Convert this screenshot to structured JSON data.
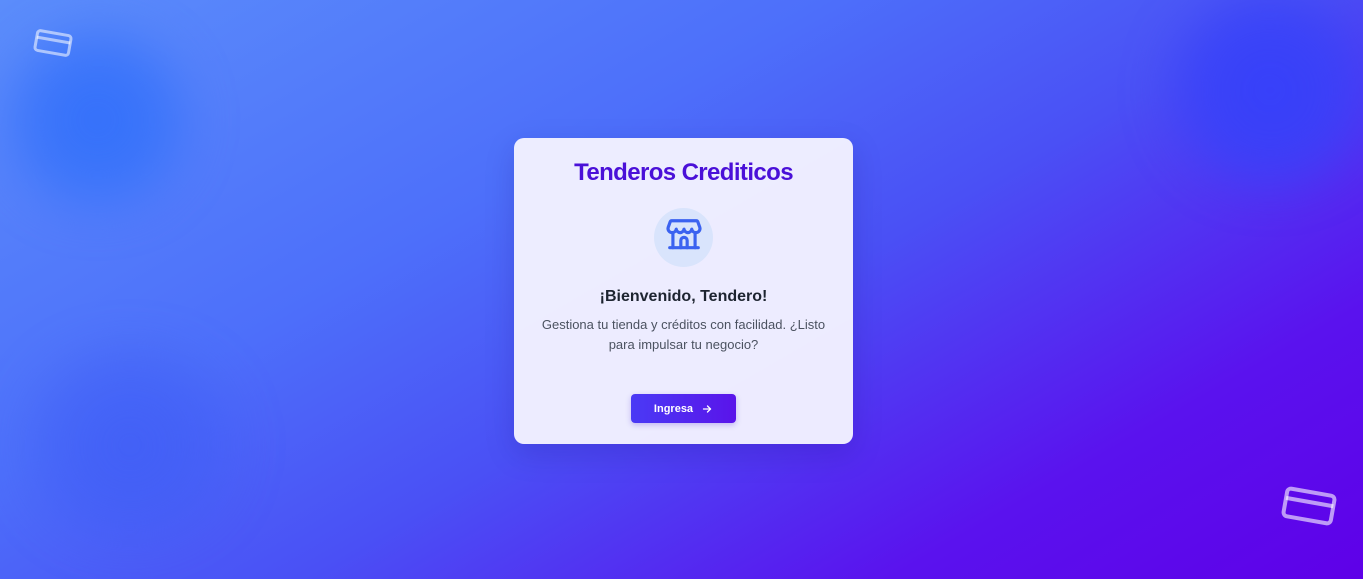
{
  "app": {
    "title": "Tenderos Crediticos"
  },
  "welcome": {
    "heading": "¡Bienvenido, Tendero!",
    "description": "Gestiona tu tienda y créditos con facilidad. ¿Listo para impulsar tu negocio?"
  },
  "actions": {
    "login_label": "Ingresa"
  },
  "icons": {
    "hero": "store-icon",
    "button": "arrow-right-icon",
    "decorations": [
      "credit-card-icon",
      "credit-card-icon"
    ]
  },
  "colors": {
    "title": "#4a10d8",
    "button_start": "#4a3af5",
    "button_end": "#5a14ea",
    "icon": "#3b62f0",
    "icon_circle": "#d9e4fc",
    "background_start": "#5b8dfb",
    "background_end": "#5e00e8"
  }
}
